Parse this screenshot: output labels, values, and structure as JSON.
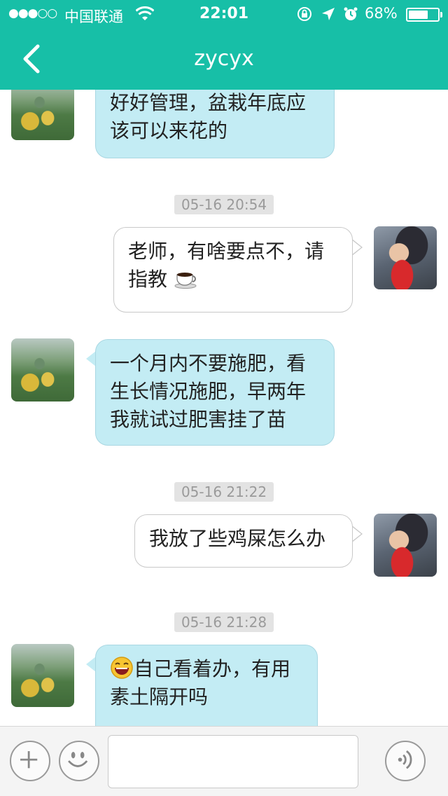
{
  "status_bar": {
    "signal": "●●●○○",
    "carrier": "中国联通",
    "time": "22:01",
    "battery_percent": "68%",
    "battery_level": 0.68,
    "icons": [
      "wifi-icon",
      "rotation-lock-icon",
      "location-arrow-icon",
      "alarm-icon",
      "battery-icon"
    ]
  },
  "nav": {
    "title": "zycyx",
    "back_icon": "chevron-left-icon"
  },
  "messages": [
    {
      "sender": "other",
      "lines": [
        "好好管理，盆栽年底应",
        "该可以来花的"
      ]
    },
    {
      "timestamp": "05-16 20:54"
    },
    {
      "sender": "me",
      "lines": [
        "老师，有啥要点不，请",
        "指教"
      ],
      "emoji_after": "coffee-emoji"
    },
    {
      "sender": "other",
      "lines": [
        "一个月内不要施肥，看",
        "生长情况施肥，早两年",
        "我就试过肥害挂了苗"
      ]
    },
    {
      "timestamp": "05-16 21:22"
    },
    {
      "sender": "me",
      "lines": [
        "我放了些鸡屎怎么办"
      ]
    },
    {
      "timestamp": "05-16 21:28"
    },
    {
      "sender": "other",
      "lines": [
        "自己看着办，有用",
        "素土隔开吗"
      ],
      "emoji_before": "laughing-emoji"
    }
  ],
  "texts": {
    "m0_l0": "好好管理，盆栽年底应",
    "m0_l1": "该可以来花的",
    "ts1": "05-16 20:54",
    "m1_l0": "老师，有啥要点不，请",
    "m1_l1": "指教",
    "m2_l0": "一个月内不要施肥，看",
    "m2_l1": "生长情况施肥，早两年",
    "m2_l2": "我就试过肥害挂了苗",
    "ts2": "05-16 21:22",
    "m3_l0": "我放了些鸡屎怎么办",
    "ts3": "05-16 21:28",
    "m4_l0": "自己看着办，有用",
    "m4_l1": "素土隔开吗"
  },
  "input_bar": {
    "plus_icon": "plus-icon",
    "emoji_icon": "smiley-icon",
    "voice_icon": "voice-icon",
    "input_value": ""
  },
  "colors": {
    "header": "#17bfa7",
    "incoming_bubble": "#c3ecf4",
    "outgoing_bubble": "#ffffff",
    "timestamp_bg": "#e3e3e3"
  }
}
